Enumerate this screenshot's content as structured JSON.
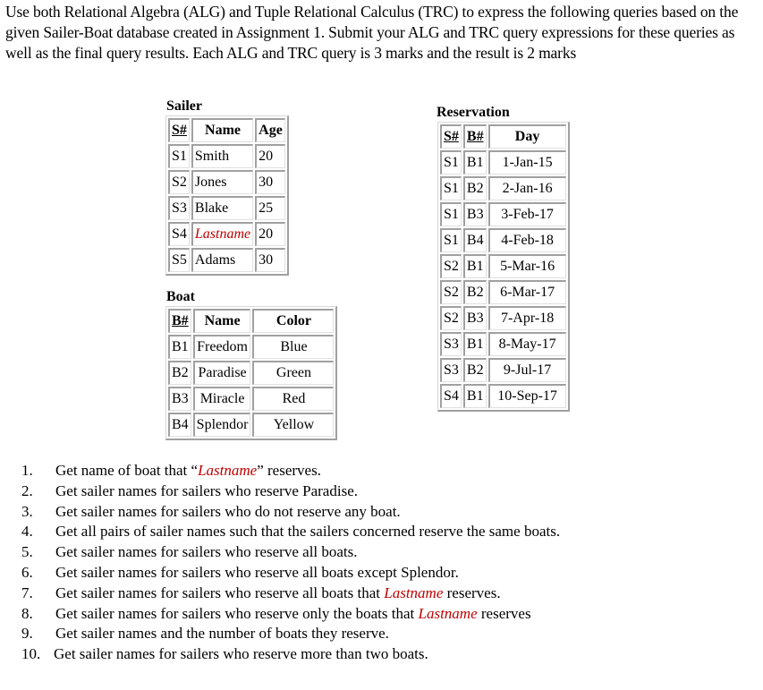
{
  "intro": "Use both Relational Algebra (ALG) and Tuple Relational Calculus (TRC) to express the following queries based on the given Sailer-Boat database created in Assignment 1. Submit your ALG and TRC query expressions for these queries as well as the final query results. Each ALG and TRC query is 3 marks and the result is 2 marks",
  "highlight_color": "#c00000",
  "sailer": {
    "caption": "Sailer",
    "headers": [
      "S#",
      "Name",
      "Age"
    ],
    "rows": [
      [
        "S1",
        "Smith",
        "20"
      ],
      [
        "S2",
        "Jones",
        "30"
      ],
      [
        "S3",
        "Blake",
        "25"
      ],
      [
        "S4",
        "Lastname",
        "20"
      ],
      [
        "S5",
        "Adams",
        "30"
      ]
    ]
  },
  "boat": {
    "caption": "Boat",
    "headers": [
      "B#",
      "Name",
      "Color"
    ],
    "rows": [
      [
        "B1",
        "Freedom",
        "Blue"
      ],
      [
        "B2",
        "Paradise",
        "Green"
      ],
      [
        "B3",
        "Miracle",
        "Red"
      ],
      [
        "B4",
        "Splendor",
        "Yellow"
      ]
    ]
  },
  "reservation": {
    "caption": "Reservation",
    "headers": [
      "S#",
      "B#",
      "Day"
    ],
    "rows": [
      [
        "S1",
        "B1",
        "1-Jan-15"
      ],
      [
        "S1",
        "B2",
        "2-Jan-16"
      ],
      [
        "S1",
        "B3",
        "3-Feb-17"
      ],
      [
        "S1",
        "B4",
        "4-Feb-18"
      ],
      [
        "S2",
        "B1",
        "5-Mar-16"
      ],
      [
        "S2",
        "B2",
        "6-Mar-17"
      ],
      [
        "S2",
        "B3",
        "7-Apr-18"
      ],
      [
        "S3",
        "B1",
        "8-May-17"
      ],
      [
        "S3",
        "B2",
        "9-Jul-17"
      ],
      [
        "S4",
        "B1",
        "10-Sep-17"
      ]
    ]
  },
  "queries": [
    {
      "num": "1.",
      "pre": "Get name of boat that “",
      "em": "Lastname",
      "post": "” reserves."
    },
    {
      "num": "2.",
      "pre": "Get sailer names for sailers who reserve Paradise.",
      "em": "",
      "post": ""
    },
    {
      "num": "3.",
      "pre": "Get sailer names for sailers who do not reserve any boat.",
      "em": "",
      "post": ""
    },
    {
      "num": "4.",
      "pre": "Get all pairs of sailer names such that the sailers concerned reserve the same boats.",
      "em": "",
      "post": ""
    },
    {
      "num": "5.",
      "pre": "Get sailer names for sailers who reserve all boats.",
      "em": "",
      "post": ""
    },
    {
      "num": "6.",
      "pre": "Get sailer names for sailers who reserve all boats except Splendor.",
      "em": "",
      "post": ""
    },
    {
      "num": "7.",
      "pre": "Get sailer names for sailers who reserve all boats that ",
      "em": "Lastname",
      "post": " reserves."
    },
    {
      "num": "8.",
      "pre": "Get sailer names for sailers who reserve only the boats that ",
      "em": "Lastname",
      "post": " reserves"
    },
    {
      "num": "9.",
      "pre": "Get sailer names and the number of boats they reserve.",
      "em": "",
      "post": ""
    },
    {
      "num": "10.",
      "pre": "Get sailer names for sailers who reserve more than two boats.",
      "em": "",
      "post": ""
    }
  ]
}
